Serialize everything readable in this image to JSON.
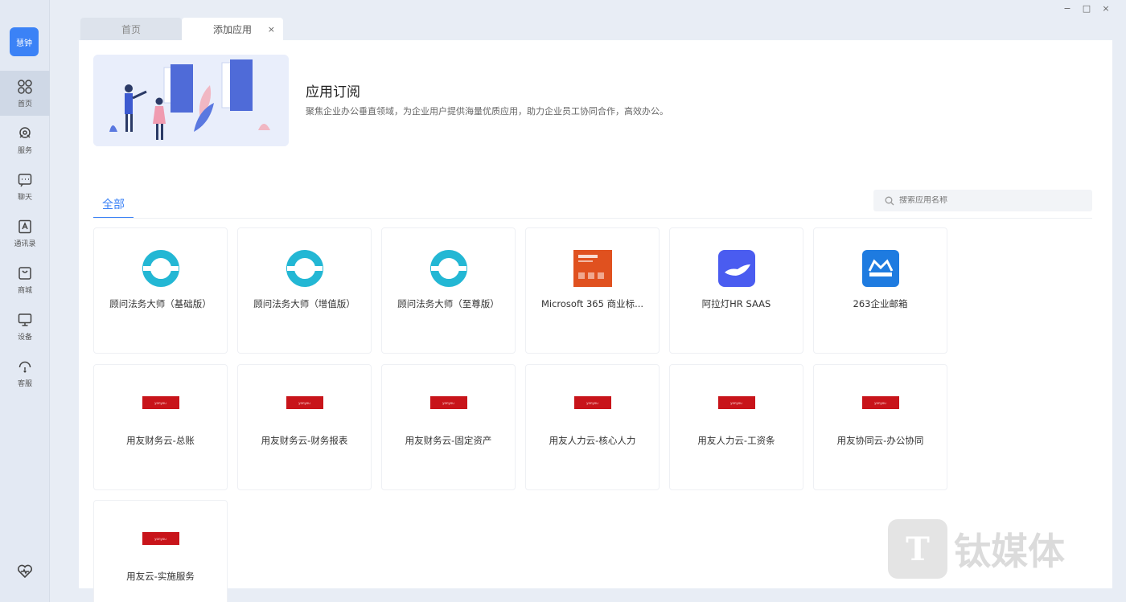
{
  "window": {
    "controls": [
      "−",
      "□",
      "×"
    ]
  },
  "sidebar": {
    "logo": "慧钟",
    "items": [
      {
        "label": "首页",
        "icon": "grid-icon",
        "active": true
      },
      {
        "label": "服务",
        "icon": "service-icon"
      },
      {
        "label": "聊天",
        "icon": "chat-icon"
      },
      {
        "label": "通讯录",
        "icon": "contacts-icon"
      },
      {
        "label": "商城",
        "icon": "store-icon"
      },
      {
        "label": "设备",
        "icon": "monitor-icon"
      },
      {
        "label": "客服",
        "icon": "support-icon"
      }
    ],
    "bottom_icon": "heart-icon"
  },
  "tabs": [
    {
      "label": "首页"
    },
    {
      "label": "添加应用",
      "close": "×"
    }
  ],
  "banner": {
    "title": "应用订阅",
    "desc": "聚焦企业办公垂直领域，为企业用户提供海量优质应用，助力企业员工协同合作，高效办公。"
  },
  "filter": {
    "active_tab": "全部",
    "search_placeholder": "搜索应用名称"
  },
  "apps": [
    {
      "name": "顾问法务大师（基础版）",
      "icon": "cyan-ring"
    },
    {
      "name": "顾问法务大师（增值版）",
      "icon": "cyan-ring"
    },
    {
      "name": "顾问法务大师（至尊版）",
      "icon": "cyan-ring"
    },
    {
      "name": "Microsoft 365 商业标...",
      "icon": "ms365"
    },
    {
      "name": "阿拉灯HR SAAS",
      "icon": "lamp"
    },
    {
      "name": "263企业邮箱",
      "icon": "mail263"
    },
    {
      "name": "用友财务云-总账",
      "icon": "red-banner"
    },
    {
      "name": "用友财务云-财务报表",
      "icon": "red-banner"
    },
    {
      "name": "用友财务云-固定资产",
      "icon": "red-banner"
    },
    {
      "name": "用友人力云-核心人力",
      "icon": "red-banner"
    },
    {
      "name": "用友人力云-工资条",
      "icon": "red-banner"
    },
    {
      "name": "用友协同云-办公协同",
      "icon": "red-banner"
    },
    {
      "name": "用友云-实施服务",
      "icon": "red-banner"
    }
  ],
  "watermark": {
    "logo_text": "T",
    "text": "钛媒体"
  }
}
